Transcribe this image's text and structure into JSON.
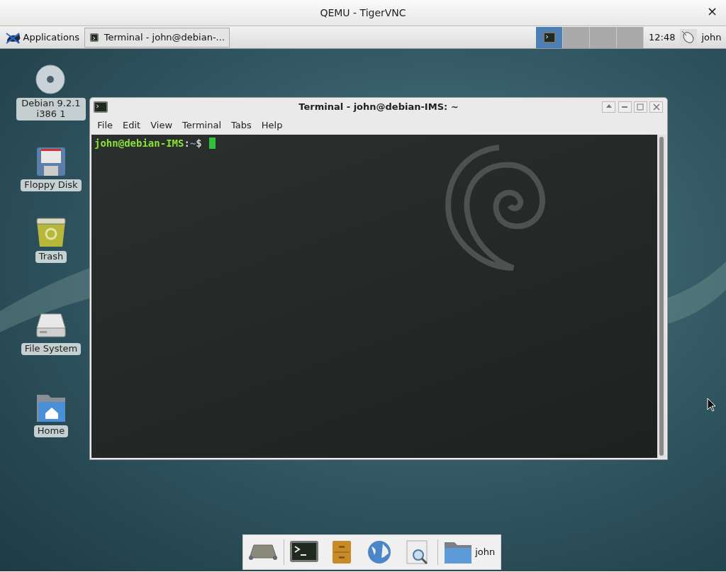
{
  "window": {
    "title": "QEMU - TigerVNC",
    "close": "×"
  },
  "panel": {
    "applications": "Applications",
    "tasks": [
      {
        "label": "Terminal - john@debian-...",
        "selected": true
      }
    ],
    "workspaces": [
      {
        "selected": true,
        "has_window": true
      },
      {
        "selected": false,
        "has_window": false
      },
      {
        "selected": false,
        "has_window": false
      },
      {
        "selected": false,
        "has_window": false
      }
    ],
    "clock": "12:48",
    "user": "john"
  },
  "desktop_icons": [
    {
      "kind": "disc",
      "label": "Debian 9.2.1 i386 1"
    },
    {
      "kind": "floppy",
      "label": "Floppy Disk"
    },
    {
      "kind": "trash",
      "label": "Trash"
    },
    {
      "kind": "drive",
      "label": "File System"
    },
    {
      "kind": "home",
      "label": "Home"
    }
  ],
  "terminal": {
    "title": "Terminal - john@debian-IMS: ~",
    "menu": [
      "File",
      "Edit",
      "View",
      "Terminal",
      "Tabs",
      "Help"
    ],
    "prompt": {
      "user_host": "john@debian-IMS",
      "separator": ":",
      "path": "~",
      "symbol": "$"
    }
  },
  "dock": {
    "items": [
      {
        "kind": "desktop"
      },
      {
        "kind": "terminal"
      },
      {
        "kind": "files"
      },
      {
        "kind": "browser"
      },
      {
        "kind": "search"
      },
      {
        "kind": "folder"
      }
    ],
    "folder_label": "john"
  }
}
